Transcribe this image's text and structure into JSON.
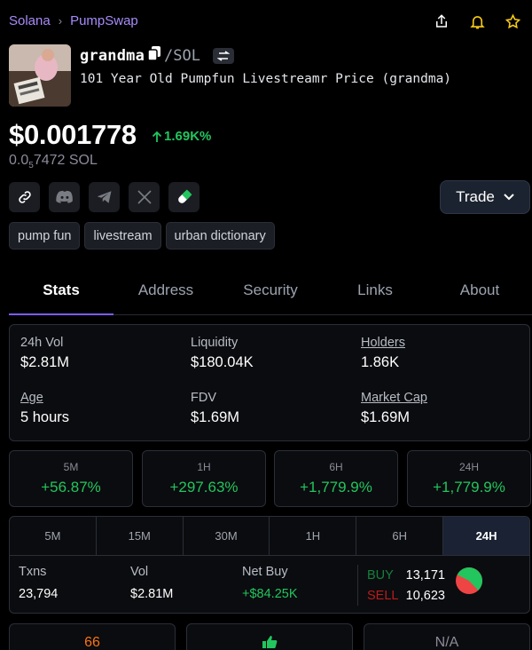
{
  "breadcrumb": {
    "chain": "Solana",
    "sep": "›",
    "dex": "PumpSwap"
  },
  "token": {
    "name": "grandma",
    "pair": "/SOL",
    "full_name": "101 Year Old Pumpfun Livestreamr Price (grandma)",
    "price_usd": "$0.001778",
    "change": "1.69K%",
    "price_sol_prefix": "0.0",
    "price_sol_sub": "5",
    "price_sol_rest": "7472 SOL"
  },
  "trade_label": "Trade",
  "tags": [
    "pump fun",
    "livestream",
    "urban dictionary"
  ],
  "tabs": [
    "Stats",
    "Address",
    "Security",
    "Links",
    "About"
  ],
  "stats": {
    "vol_label": "24h Vol",
    "vol_value": "$2.81M",
    "liq_label": "Liquidity",
    "liq_value": "$180.04K",
    "holders_label": "Holders",
    "holders_value": "1.86K",
    "age_label": "Age",
    "age_value": "5 hours",
    "fdv_label": "FDV",
    "fdv_value": "$1.69M",
    "mcap_label": "Market Cap",
    "mcap_value": "$1.69M"
  },
  "changes": [
    {
      "label": "5M",
      "value": "+56.87%"
    },
    {
      "label": "1H",
      "value": "+297.63%"
    },
    {
      "label": "6H",
      "value": "+1,779.9%"
    },
    {
      "label": "24H",
      "value": "+1,779.9%"
    }
  ],
  "periods": [
    "5M",
    "15M",
    "30M",
    "1H",
    "6H",
    "24H"
  ],
  "txns": {
    "txns_label": "Txns",
    "txns_value": "23,794",
    "vol_label": "Vol",
    "vol_value": "$2.81M",
    "netbuy_label": "Net Buy",
    "netbuy_value": "+$84.25K",
    "buy_label": "BUY",
    "buy_value": "13,171",
    "sell_label": "SELL",
    "sell_value": "10,623",
    "buy_fraction": 0.5535
  },
  "bottom": {
    "left": "66",
    "right": "N/A"
  },
  "colors": {
    "accent": "#7c5cff",
    "positive": "#22c55e",
    "negative": "#ef4444",
    "link": "#a78bfa"
  }
}
